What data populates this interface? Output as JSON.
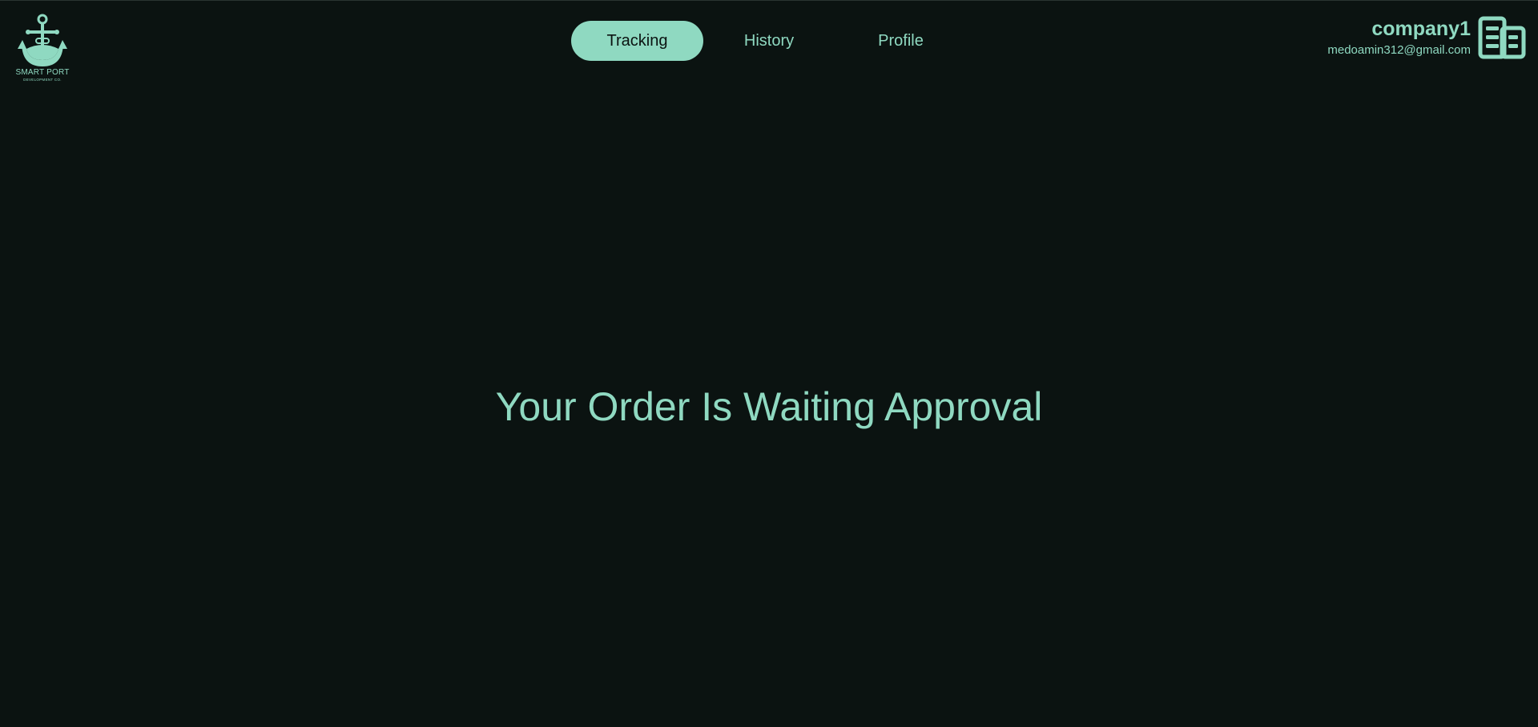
{
  "logo": {
    "title": "SMART PORT",
    "subtitle": "DEVELOPMENT CO.",
    "icon": "anchor-icon"
  },
  "nav": {
    "items": [
      {
        "label": "Tracking",
        "active": true
      },
      {
        "label": "History",
        "active": false
      },
      {
        "label": "Profile",
        "active": false
      }
    ]
  },
  "user": {
    "company": "company1",
    "email": "medoamin312@gmail.com",
    "icon": "building-icon"
  },
  "main": {
    "message": "Your Order Is Waiting Approval"
  },
  "colors": {
    "background": "#0b1311",
    "accent": "#8fd9c1"
  }
}
